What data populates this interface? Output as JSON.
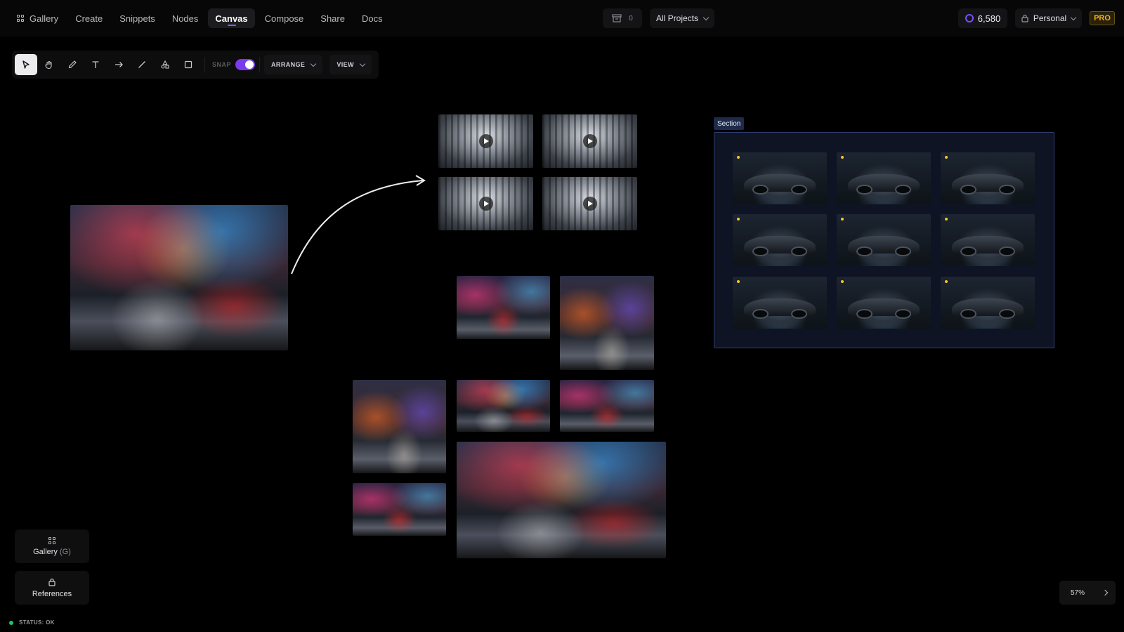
{
  "nav": {
    "items": [
      {
        "label": "Gallery",
        "icon": "grid-icon"
      },
      {
        "label": "Create"
      },
      {
        "label": "Snippets"
      },
      {
        "label": "Nodes"
      },
      {
        "label": "Canvas",
        "active": true
      },
      {
        "label": "Compose"
      },
      {
        "label": "Share"
      },
      {
        "label": "Docs"
      }
    ]
  },
  "header": {
    "queue_count": "0",
    "projects_label": "All Projects",
    "credits": "6,580",
    "workspace_label": "Personal",
    "plan_badge": "PRO",
    "accent_color": "#8b5cf6",
    "pro_color": "#f2b01e"
  },
  "toolbar": {
    "tools": [
      "select-tool",
      "hand-tool",
      "pen-tool",
      "text-tool",
      "arrow-tool",
      "line-tool",
      "shapes-tool",
      "frame-tool"
    ],
    "snap_label": "SNAP",
    "snap_on": true,
    "arrange_label": "ARRANGE",
    "view_label": "VIEW"
  },
  "canvas": {
    "section_label": "Section"
  },
  "bottom": {
    "gallery_label": "Gallery",
    "gallery_shortcut": "(G)",
    "references_label": "References",
    "status_text": "STATUS: OK",
    "status_color": "#22c55e",
    "zoom_level": "57%"
  }
}
